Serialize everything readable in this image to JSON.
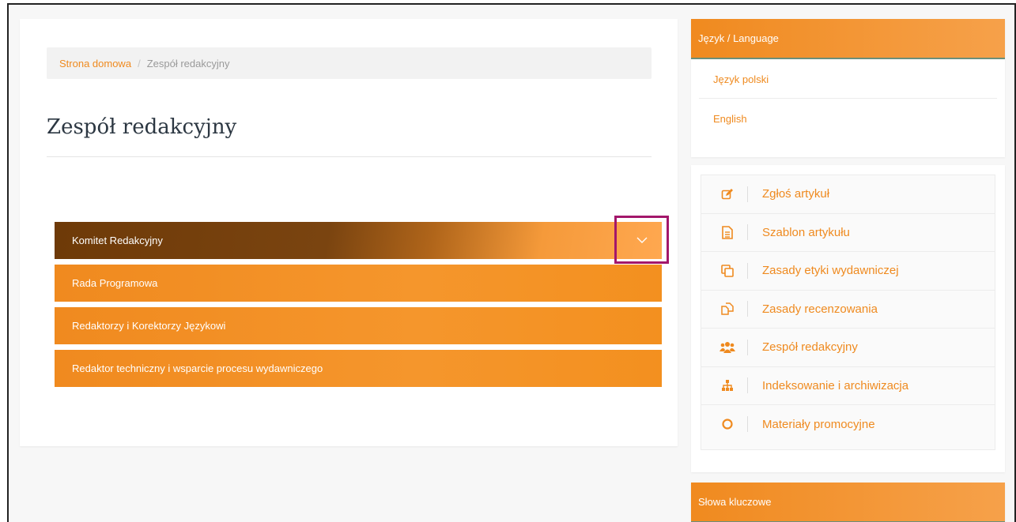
{
  "breadcrumb": {
    "home": "Strona domowa",
    "separator": "/",
    "current": "Zespół redakcyjny"
  },
  "page_title": "Zespół redakcyjny",
  "accordion": [
    {
      "label": "Komitet Redakcyjny",
      "active": true
    },
    {
      "label": "Rada Programowa"
    },
    {
      "label": "Redaktorzy i Korektorzy Językowi"
    },
    {
      "label": "Redaktor techniczny i wsparcie procesu wydawniczego"
    }
  ],
  "language": {
    "title": "Język / Language",
    "items": [
      "Język polski",
      "English"
    ]
  },
  "links": [
    {
      "label": "Zgłoś artykuł",
      "icon": "edit-icon"
    },
    {
      "label": "Szablon artykułu",
      "icon": "file-text-icon"
    },
    {
      "label": "Zasady etyki wydawniczej",
      "icon": "copy-icon"
    },
    {
      "label": "Zasady recenzowania",
      "icon": "documents-icon"
    },
    {
      "label": "Zespół redakcyjny",
      "icon": "users-icon"
    },
    {
      "label": "Indeksowanie i archiwizacja",
      "icon": "sitemap-icon"
    },
    {
      "label": "Materiały promocyjne",
      "icon": "circle-icon"
    }
  ],
  "keywords": {
    "title": "Słowa kluczowe"
  },
  "colors": {
    "accent": "#ef8a1f",
    "active_dark": "#6e3a08",
    "highlight": "#a3176b",
    "title": "#2c3742"
  }
}
